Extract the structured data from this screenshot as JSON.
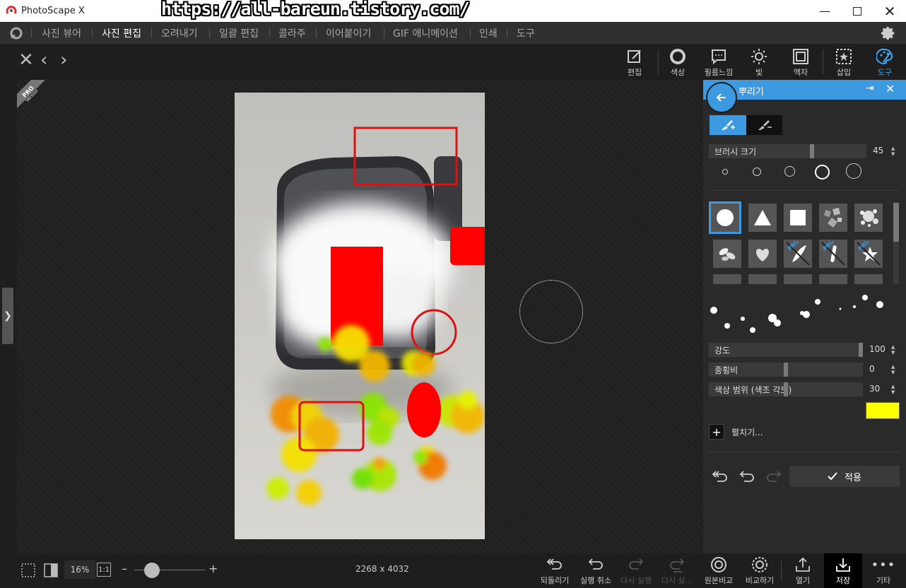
{
  "window": {
    "app_title": "PhotoScape X",
    "watermark_url": "https://all-bareun.tistory.com/",
    "min_icon": "minimize-icon",
    "max_icon": "maximize-icon",
    "close_icon": "close-icon"
  },
  "menu": {
    "items": [
      "사진 뷰어",
      "사진 편집",
      "오려내기",
      "일괄 편집",
      "콜라주",
      "이어붙이기",
      "GIF 애니메이션",
      "인쇄",
      "도구"
    ],
    "active_index": 1
  },
  "tools": [
    {
      "label": "편집",
      "icon": "edit-icon"
    },
    {
      "label": "색상",
      "icon": "color-circle-icon"
    },
    {
      "label": "필름느낌",
      "icon": "film-icon"
    },
    {
      "label": "빛",
      "icon": "sun-icon"
    },
    {
      "label": "액자",
      "icon": "frame-icon"
    },
    {
      "label": "삽입",
      "icon": "insert-icon"
    },
    {
      "label": "도구",
      "icon": "palette-icon"
    }
  ],
  "badge": {
    "line1": "PRO",
    "line2": "Version"
  },
  "panel": {
    "title": "뿌리기",
    "brush_size": {
      "label": "브러시 크기",
      "value": "45",
      "level": 0.66
    },
    "intensity": {
      "label": "강도",
      "value": "100",
      "level": 1.0
    },
    "aspect": {
      "label": "종횡비",
      "value": "0",
      "level": 0.5
    },
    "hue_range": {
      "label": "색상 범위 (색조 각도)",
      "value": "30",
      "level": 0.5
    },
    "color": "#ffff00",
    "expand_label": "펼치기...",
    "apply_label": "적용",
    "brush_pro_label": "PRO"
  },
  "status": {
    "zoom": "16%",
    "one_to_one": "1:1",
    "dimensions": "2268 x 4032",
    "zoom_level": 0.25
  },
  "bottom_buttons": [
    {
      "label": "되돌리기",
      "icon": "revert-icon",
      "enabled": true
    },
    {
      "label": "실행 취소",
      "icon": "undo-icon",
      "enabled": true
    },
    {
      "label": "다시 실행",
      "icon": "redo-icon",
      "enabled": false
    },
    {
      "label": "다시 실...",
      "icon": "redo-all-icon",
      "enabled": false
    },
    {
      "label": "원본비교",
      "icon": "compare-original-icon",
      "enabled": true
    },
    {
      "label": "비교하기",
      "icon": "compare-icon",
      "enabled": true
    },
    {
      "label": "열기",
      "icon": "open-icon",
      "enabled": true
    },
    {
      "label": "저장",
      "icon": "save-icon",
      "enabled": true
    },
    {
      "label": "기타",
      "icon": "more-icon",
      "enabled": true
    }
  ]
}
